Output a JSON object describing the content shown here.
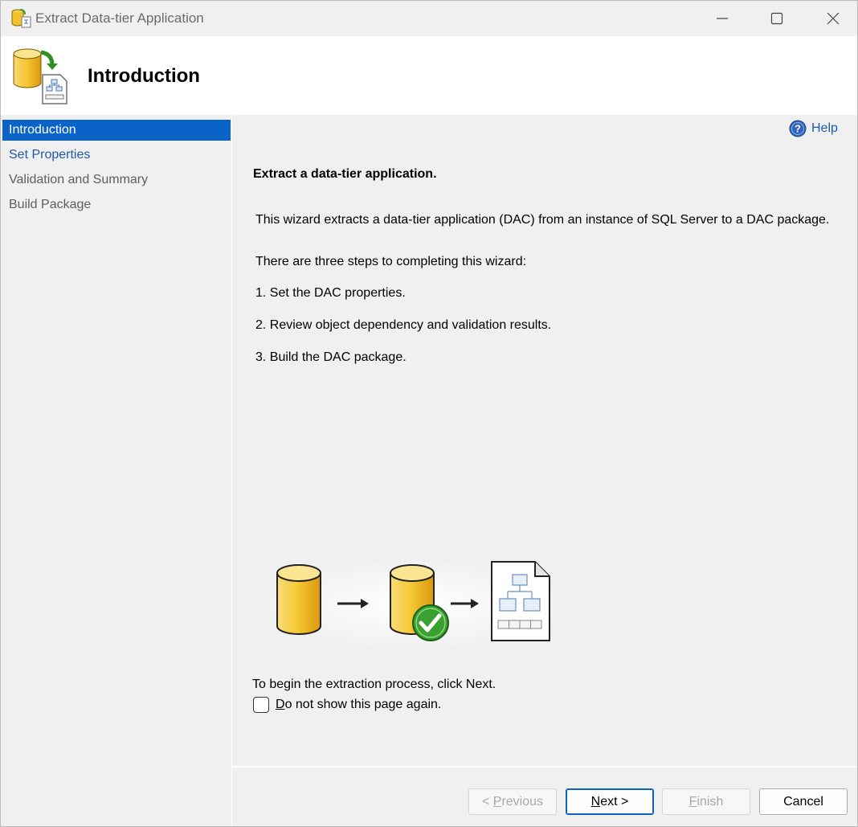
{
  "window": {
    "title": "Extract Data-tier Application"
  },
  "header": {
    "title": "Introduction"
  },
  "nav": {
    "items": [
      {
        "label": "Introduction",
        "state": "active"
      },
      {
        "label": "Set Properties",
        "state": "link"
      },
      {
        "label": "Validation and Summary",
        "state": "disabled"
      },
      {
        "label": "Build Package",
        "state": "disabled"
      }
    ]
  },
  "content": {
    "help_label": "Help",
    "heading": "Extract a data-tier application.",
    "description": "This wizard extracts a data-tier application (DAC) from an instance of SQL Server to a DAC package.",
    "steps_intro": "There are three steps to completing this wizard:",
    "steps": [
      "1. Set the DAC properties.",
      "2. Review object dependency and validation results.",
      "3. Build the DAC package."
    ],
    "begin_text": "To begin the extraction process, click Next.",
    "checkbox_label_accel": "D",
    "checkbox_label_rest": "o not show this page again.",
    "checkbox_checked": false
  },
  "buttons": {
    "previous_prefix": "< ",
    "previous_accel": "P",
    "previous_rest": "revious",
    "next_accel": "N",
    "next_rest": "ext >",
    "finish_accel": "F",
    "finish_rest": "inish",
    "cancel": "Cancel"
  },
  "colors": {
    "accent": "#0a64c8",
    "link": "#1d5aa8",
    "database_yellow": "#f5c431",
    "check_green": "#3aa02f"
  },
  "icons": {
    "app": "database-extract-icon",
    "help": "help-icon",
    "checkmark": "checkmark-icon",
    "package": "package-document-icon"
  }
}
